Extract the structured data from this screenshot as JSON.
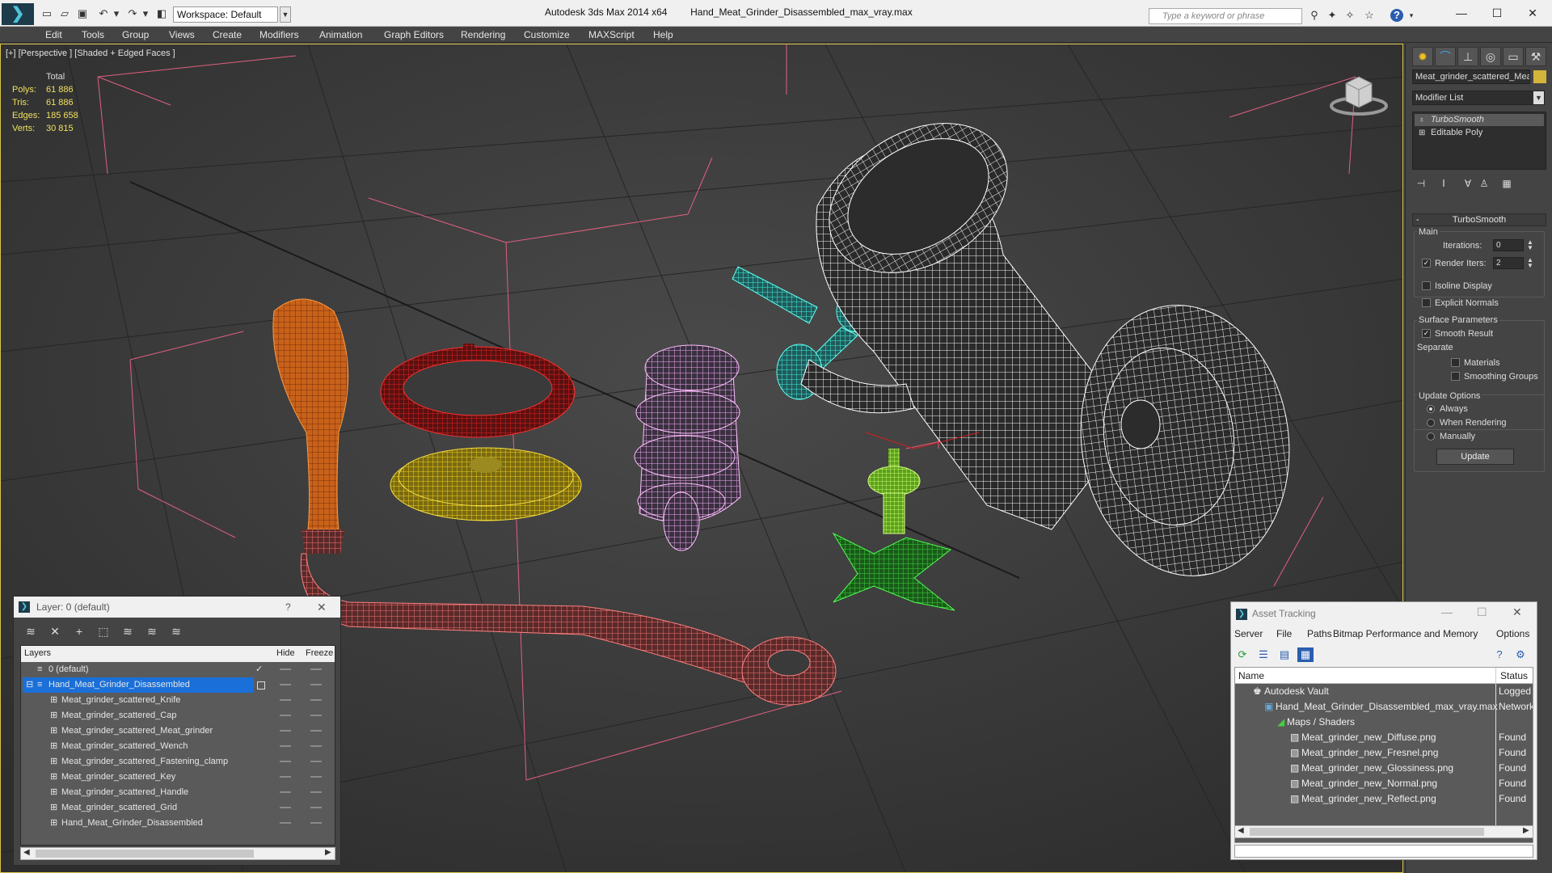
{
  "titlebar": {
    "workspace": "Workspace: Default",
    "app_name": "Autodesk 3ds Max  2014 x64",
    "file_name": "Hand_Meat_Grinder_Disassembled_max_vray.max",
    "search_placeholder": "Type a keyword or phrase"
  },
  "menu": [
    "Edit",
    "Tools",
    "Group",
    "Views",
    "Create",
    "Modifiers",
    "Animation",
    "Graph Editors",
    "Rendering",
    "Customize",
    "MAXScript",
    "Help"
  ],
  "viewport": {
    "label": "[+] [Perspective ] [Shaded + Edged Faces ]",
    "stats": {
      "header": "Total",
      "rows": [
        {
          "label": "Polys:",
          "value": "61 886"
        },
        {
          "label": "Tris:",
          "value": "61 886"
        },
        {
          "label": "Edges:",
          "value": "185 658"
        },
        {
          "label": "Verts:",
          "value": "30 815"
        }
      ]
    }
  },
  "command_panel": {
    "object_name": "Meat_grinder_scattered_Meat",
    "object_color": "#d4b43a",
    "modifier_list": "Modifier List",
    "stack": [
      "TurboSmooth",
      "Editable Poly"
    ],
    "rollout_title": "TurboSmooth",
    "main_group": "Main",
    "iterations_label": "Iterations:",
    "iterations_value": "0",
    "render_iters_label": "Render Iters:",
    "render_iters_value": "2",
    "render_iters_checked": true,
    "isoline_label": "Isoline Display",
    "explicit_label": "Explicit Normals",
    "surface_group": "Surface Parameters",
    "smooth_result_label": "Smooth Result",
    "separate_label": "Separate",
    "materials_label": "Materials",
    "smoothing_groups_label": "Smoothing Groups",
    "update_group": "Update Options",
    "radio_always": "Always",
    "radio_rendering": "When Rendering",
    "radio_manually": "Manually",
    "update_button": "Update"
  },
  "layer_dialog": {
    "title": "Layer: 0 (default)",
    "help": "?",
    "col_layers": "Layers",
    "col_hide": "Hide",
    "col_freeze": "Freeze",
    "rows": [
      {
        "name": "0 (default)",
        "level": 1,
        "selected": false,
        "current": true
      },
      {
        "name": "Hand_Meat_Grinder_Disassembled",
        "level": 1,
        "selected": true,
        "current": false
      },
      {
        "name": "Meat_grinder_scattered_Knife",
        "level": 2,
        "selected": false,
        "current": false
      },
      {
        "name": "Meat_grinder_scattered_Cap",
        "level": 2,
        "selected": false,
        "current": false
      },
      {
        "name": "Meat_grinder_scattered_Meat_grinder",
        "level": 2,
        "selected": false,
        "current": false
      },
      {
        "name": "Meat_grinder_scattered_Wench",
        "level": 2,
        "selected": false,
        "current": false
      },
      {
        "name": "Meat_grinder_scattered_Fastening_clamp",
        "level": 2,
        "selected": false,
        "current": false
      },
      {
        "name": "Meat_grinder_scattered_Key",
        "level": 2,
        "selected": false,
        "current": false
      },
      {
        "name": "Meat_grinder_scattered_Handle",
        "level": 2,
        "selected": false,
        "current": false
      },
      {
        "name": "Meat_grinder_scattered_Grid",
        "level": 2,
        "selected": false,
        "current": false
      },
      {
        "name": "Hand_Meat_Grinder_Disassembled",
        "level": 2,
        "selected": false,
        "current": false
      }
    ]
  },
  "asset_dialog": {
    "title": "Asset Tracking",
    "menu": [
      "Server",
      "File",
      "Paths",
      "Bitmap Performance and Memory",
      "Options"
    ],
    "col_name": "Name",
    "col_status": "Status",
    "rows": [
      {
        "name": "Autodesk Vault",
        "level": 1,
        "status": "Logged O"
      },
      {
        "name": "Hand_Meat_Grinder_Disassembled_max_vray.max",
        "level": 2,
        "status": "Network"
      },
      {
        "name": "Maps / Shaders",
        "level": 3,
        "status": ""
      },
      {
        "name": "Meat_grinder_new_Diffuse.png",
        "level": 4,
        "status": "Found"
      },
      {
        "name": "Meat_grinder_new_Fresnel.png",
        "level": 4,
        "status": "Found"
      },
      {
        "name": "Meat_grinder_new_Glossiness.png",
        "level": 4,
        "status": "Found"
      },
      {
        "name": "Meat_grinder_new_Normal.png",
        "level": 4,
        "status": "Found"
      },
      {
        "name": "Meat_grinder_new_Reflect.png",
        "level": 4,
        "status": "Found"
      }
    ]
  }
}
